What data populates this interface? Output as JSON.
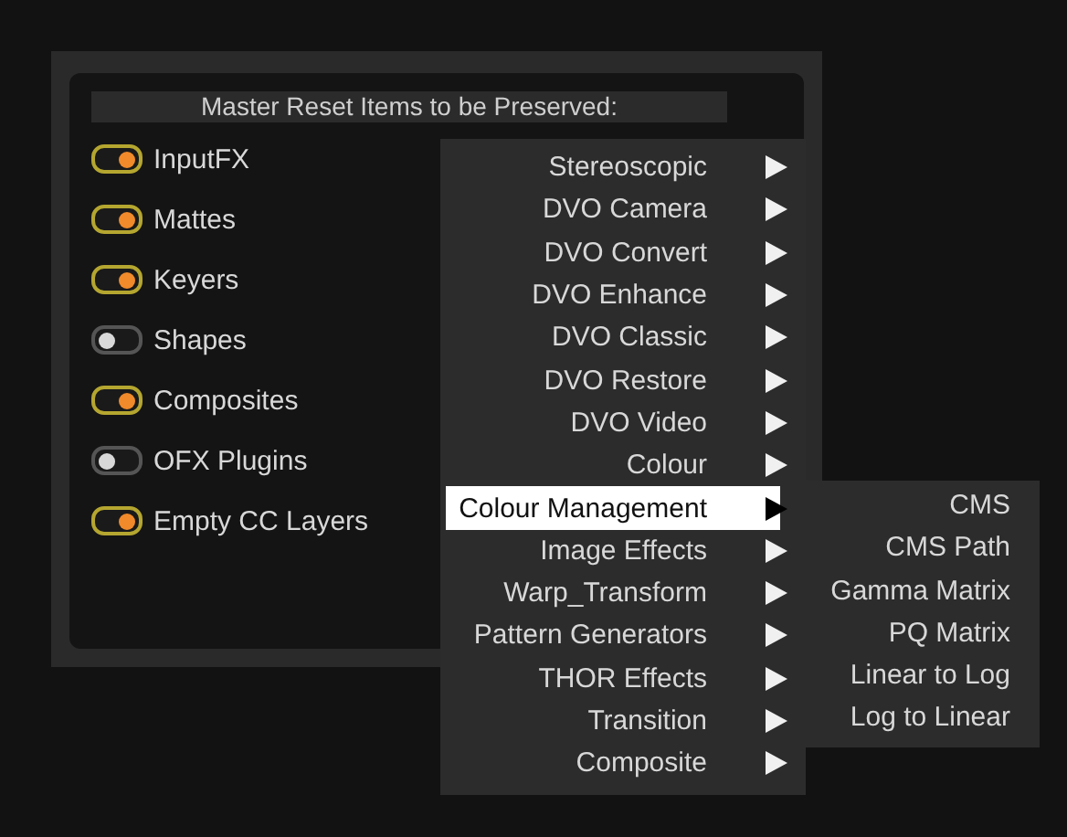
{
  "panel": {
    "title": "Master Reset Items to be Preserved:",
    "items": [
      {
        "label": "InputFX",
        "on": true
      },
      {
        "label": "Mattes",
        "on": true
      },
      {
        "label": "Keyers",
        "on": true
      },
      {
        "label": "Shapes",
        "on": false
      },
      {
        "label": "Composites",
        "on": true
      },
      {
        "label": "OFX Plugins",
        "on": false
      },
      {
        "label": "Empty CC Layers",
        "on": true
      }
    ]
  },
  "menu": {
    "items": [
      {
        "label": "Stereoscopic",
        "selected": false
      },
      {
        "label": "DVO Camera",
        "selected": false
      },
      {
        "label": "DVO Convert",
        "selected": false
      },
      {
        "label": "DVO Enhance",
        "selected": false
      },
      {
        "label": "DVO Classic",
        "selected": false
      },
      {
        "label": "DVO Restore",
        "selected": false
      },
      {
        "label": "DVO Video",
        "selected": false
      },
      {
        "label": "Colour",
        "selected": false
      },
      {
        "label": "Colour Management",
        "selected": true
      },
      {
        "label": "Image Effects",
        "selected": false
      },
      {
        "label": "Warp_Transform",
        "selected": false
      },
      {
        "label": "Pattern Generators",
        "selected": false
      },
      {
        "label": "THOR Effects",
        "selected": false
      },
      {
        "label": "Transition",
        "selected": false
      },
      {
        "label": "Composite",
        "selected": false
      }
    ]
  },
  "submenu": {
    "items": [
      "CMS",
      "CMS Path",
      "Gamma Matrix",
      "PQ Matrix",
      "Linear to Log",
      "Log to Linear"
    ]
  }
}
